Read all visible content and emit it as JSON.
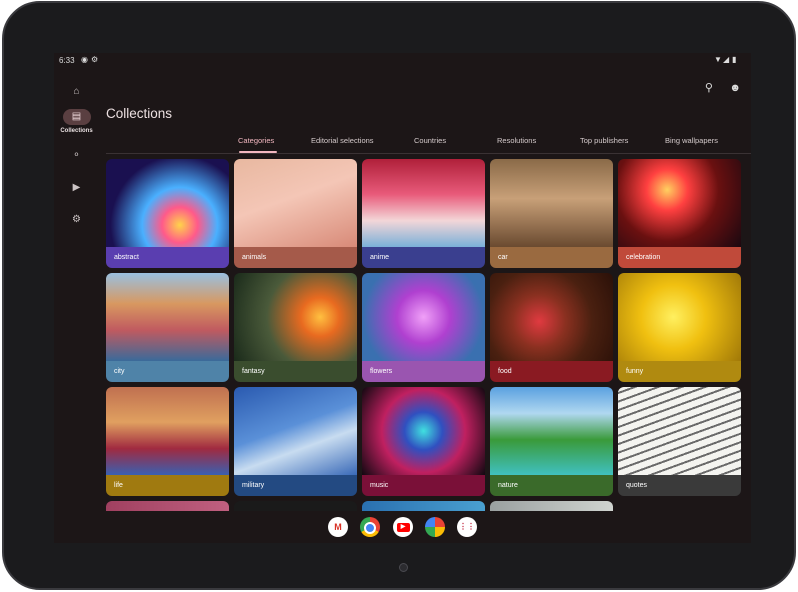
{
  "status": {
    "time": "6:33"
  },
  "rail": {
    "items": [
      {
        "icon": "home-icon",
        "label": ""
      },
      {
        "icon": "collections-icon",
        "label": "Collections"
      },
      {
        "icon": "explore-icon",
        "label": ""
      },
      {
        "icon": "video-icon",
        "label": ""
      },
      {
        "icon": "settings-icon",
        "label": ""
      }
    ]
  },
  "header": {
    "title": "Collections"
  },
  "tabs": [
    {
      "label": "Categories"
    },
    {
      "label": "Editorial selections"
    },
    {
      "label": "Countries"
    },
    {
      "label": "Resolutions"
    },
    {
      "label": "Top publishers"
    },
    {
      "label": "Bing wallpapers"
    }
  ],
  "categories": [
    {
      "label": "abstract",
      "color": "#5a3eb0"
    },
    {
      "label": "animals",
      "color": "#a55a4a"
    },
    {
      "label": "anime",
      "color": "#3a3f8f"
    },
    {
      "label": "car",
      "color": "#9a6a40"
    },
    {
      "label": "celebration",
      "color": "#c04a3a"
    },
    {
      "label": "city",
      "color": "#4f83a8"
    },
    {
      "label": "fantasy",
      "color": "#3a4d2e"
    },
    {
      "label": "flowers",
      "color": "#9a55b0"
    },
    {
      "label": "food",
      "color": "#8a1a22"
    },
    {
      "label": "funny",
      "color": "#b08a10"
    },
    {
      "label": "life",
      "color": "#a07a10"
    },
    {
      "label": "military",
      "color": "#234a82"
    },
    {
      "label": "music",
      "color": "#7a1038"
    },
    {
      "label": "nature",
      "color": "#3a6a2a"
    },
    {
      "label": "quotes",
      "color": "#3a3a3a"
    }
  ],
  "dock": {
    "apps": [
      "Gmail",
      "Chrome",
      "YouTube",
      "Photos",
      "Apps"
    ]
  }
}
